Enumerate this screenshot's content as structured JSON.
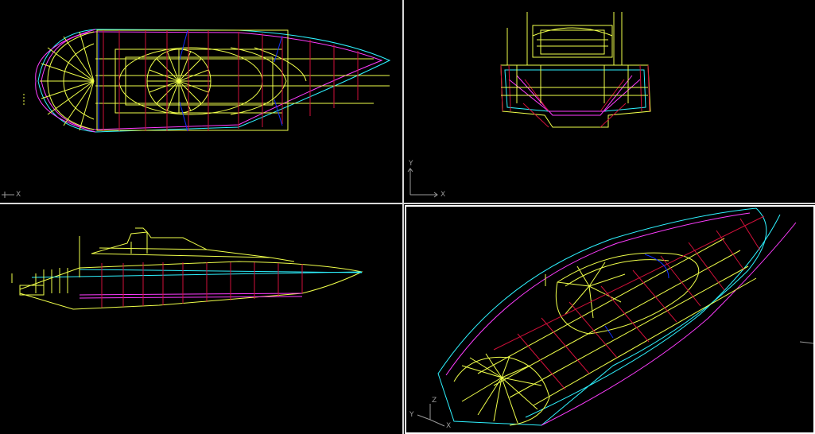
{
  "viewports": {
    "top": {
      "name": "top-view",
      "ucs": {
        "x_label": "X",
        "y_label": ""
      }
    },
    "front": {
      "name": "front-view",
      "ucs": {
        "x_label": "X",
        "y_label": "Y"
      }
    },
    "side": {
      "name": "side-view",
      "ucs": {
        "x_label": "",
        "y_label": ""
      }
    },
    "iso": {
      "name": "isometric-view",
      "active": true,
      "ucs": {
        "x_label": "X",
        "y_label": "Y",
        "z_label": "Z"
      }
    }
  },
  "colors": {
    "background": "#000000",
    "yellow": "#f0ff4a",
    "cyan": "#2ef2ff",
    "red": "#d0103a",
    "magenta": "#ff3cff",
    "blue": "#1030ff",
    "white": "#ffffff",
    "gray": "#9a9a9a",
    "separator": "#d8d8d8"
  }
}
